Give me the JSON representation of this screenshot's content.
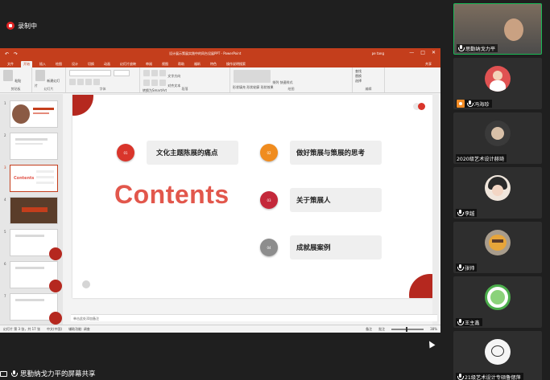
{
  "recording": {
    "label": "录制中"
  },
  "powerpoint": {
    "doc_title": "设计展示策展实践中的同台设展PPT",
    "app_name": "PowerPoint",
    "user": "pe tang",
    "quick_access": [
      "↶",
      "↷"
    ],
    "window_controls": [
      "—",
      "□",
      "✕"
    ],
    "tabs": [
      "文件",
      "开始",
      "插入",
      "绘图",
      "设计",
      "切换",
      "动画",
      "幻灯片放映",
      "审阅",
      "视图",
      "帮助",
      "福昕",
      "特色",
      "操作说明搜索"
    ],
    "active_tab": "开始",
    "share": "共享",
    "groups": [
      "剪贴板",
      "幻灯片",
      "字体",
      "段落",
      "绘图",
      "编辑"
    ],
    "ribbon_labels": {
      "paste": "粘贴",
      "new_slide": "新建幻灯片",
      "text_direction": "文字方向",
      "align_text": "对齐文本",
      "smartart": "转换为SmartArt",
      "arrange": "排列",
      "quick_styles": "快速样式",
      "shape_fill": "形状填充",
      "shape_outline": "形状轮廓",
      "shape_effects": "形状效果",
      "find": "查找",
      "replace": "替换",
      "select": "选择"
    },
    "slide_numbers": [
      "1",
      "2",
      "3",
      "4",
      "5",
      "6",
      "7"
    ],
    "notes_placeholder": "单击此处添加备注",
    "status_left": "幻灯片 第 3 张，共 17 张",
    "status_lang": "中文(中国)",
    "status_access": "辅助功能: 调查",
    "status_notes": "备注",
    "status_comments": "批注",
    "zoom": "38%"
  },
  "slide": {
    "heading": "Contents",
    "items": [
      {
        "num": "01",
        "label": "文化主题陈展的痛点",
        "color": "#d9352b"
      },
      {
        "num": "02",
        "label": "做好策展与策展的思考",
        "color": "#f08c1f"
      },
      {
        "num": "03",
        "label": "关于策展人",
        "color": "#c4283a"
      },
      {
        "num": "04",
        "label": "成就展案例",
        "color": "#8d8d8d"
      }
    ]
  },
  "participants": [
    {
      "name": "思勤纳戈力平",
      "active": true
    },
    {
      "name": "冯海珍",
      "active": false
    },
    {
      "name": "2020级艺术设计赫琦",
      "active": false
    },
    {
      "name": "李越",
      "active": false
    },
    {
      "name": "张帅",
      "active": false
    },
    {
      "name": "王主鑫",
      "active": false
    },
    {
      "name": "21级艺术设计专硕鲁偲萍",
      "active": false
    }
  ],
  "screen_share": {
    "label": "思勤纳戈力平的屏幕共享"
  }
}
